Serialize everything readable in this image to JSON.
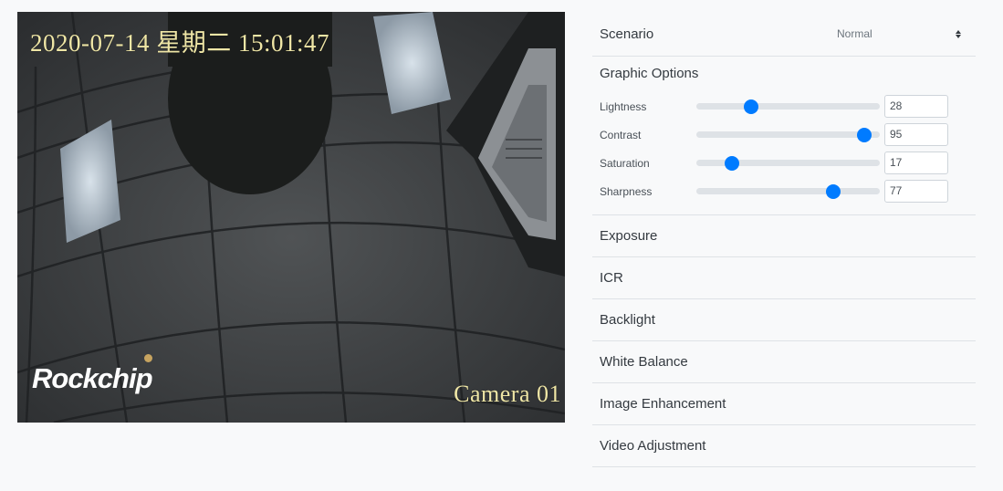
{
  "preview": {
    "osd_timestamp": "2020-07-14 星期二 15:01:47",
    "osd_camera_name": "Camera 01",
    "logo_text": "Rockchip"
  },
  "panel": {
    "scenario": {
      "label": "Scenario",
      "selected": "Normal"
    },
    "graphic_options": {
      "title": "Graphic Options",
      "sliders": [
        {
          "id": "lightness",
          "label": "Lightness",
          "value": 28
        },
        {
          "id": "contrast",
          "label": "Contrast",
          "value": 95
        },
        {
          "id": "saturation",
          "label": "Saturation",
          "value": 17
        },
        {
          "id": "sharpness",
          "label": "Sharpness",
          "value": 77
        }
      ],
      "min": 0,
      "max": 100
    },
    "sections": [
      {
        "id": "exposure",
        "label": "Exposure"
      },
      {
        "id": "icr",
        "label": "ICR"
      },
      {
        "id": "backlight",
        "label": "Backlight"
      },
      {
        "id": "white-balance",
        "label": "White Balance"
      },
      {
        "id": "image-enhancement",
        "label": "Image Enhancement"
      },
      {
        "id": "video-adjustment",
        "label": "Video Adjustment"
      }
    ]
  },
  "colors": {
    "accent": "#007bff",
    "osd_text": "#efe6a6",
    "page_bg": "#f8f9fa",
    "divider": "#dee2e6"
  }
}
